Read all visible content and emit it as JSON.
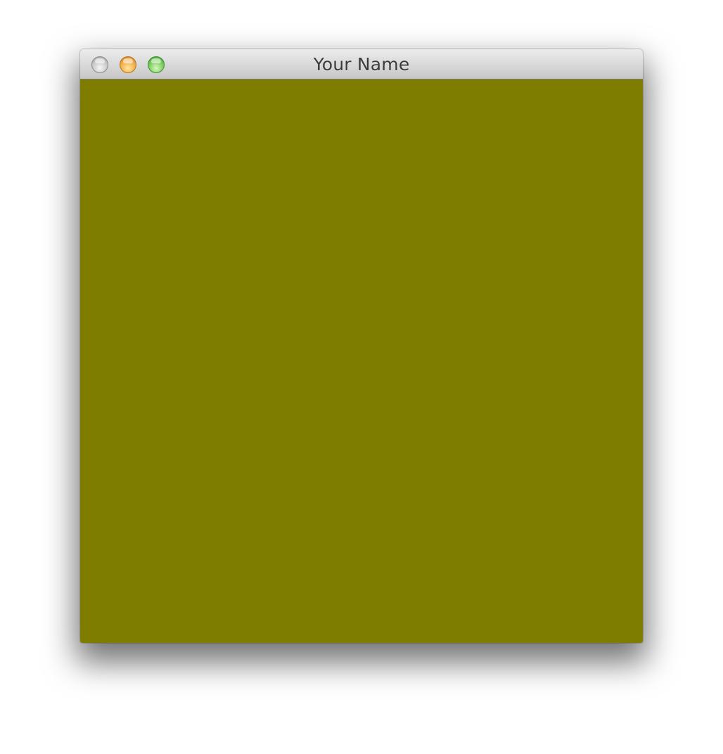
{
  "window": {
    "title": "Your Name",
    "content_color": "#7f7d00",
    "controls": {
      "close_icon": "close-icon",
      "minimize_icon": "minimize-icon",
      "zoom_icon": "zoom-icon"
    }
  }
}
